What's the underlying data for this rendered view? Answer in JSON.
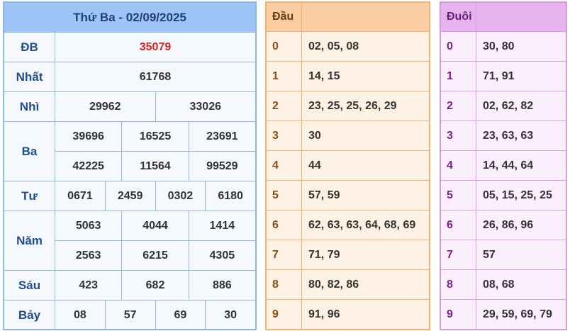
{
  "results": {
    "title": "Thứ Ba - 02/09/2025",
    "rows": [
      {
        "label": "ĐB",
        "lines": [
          [
            "35079"
          ]
        ]
      },
      {
        "label": "Nhất",
        "lines": [
          [
            "61768"
          ]
        ]
      },
      {
        "label": "Nhì",
        "lines": [
          [
            "29962",
            "33026"
          ]
        ]
      },
      {
        "label": "Ba",
        "lines": [
          [
            "39696",
            "16525",
            "23691"
          ],
          [
            "42225",
            "11564",
            "99529"
          ]
        ]
      },
      {
        "label": "Tư",
        "lines": [
          [
            "0671",
            "2459",
            "0302",
            "6180"
          ]
        ]
      },
      {
        "label": "Năm",
        "lines": [
          [
            "5063",
            "4044",
            "1414"
          ],
          [
            "2563",
            "6215",
            "4305"
          ]
        ]
      },
      {
        "label": "Sáu",
        "lines": [
          [
            "423",
            "682",
            "886"
          ]
        ]
      },
      {
        "label": "Bảy",
        "lines": [
          [
            "08",
            "57",
            "69",
            "30"
          ]
        ]
      }
    ],
    "special_color": "#e02020"
  },
  "dau": {
    "header": "Đầu",
    "rows": [
      {
        "k": "0",
        "v": "02, 05, 08"
      },
      {
        "k": "1",
        "v": "14, 15"
      },
      {
        "k": "2",
        "v": "23, 25, 25, 26, 29"
      },
      {
        "k": "3",
        "v": "30"
      },
      {
        "k": "4",
        "v": "44"
      },
      {
        "k": "5",
        "v": "57, 59"
      },
      {
        "k": "6",
        "v": "62, 63, 63, 64, 68, 69"
      },
      {
        "k": "7",
        "v": "71, 79"
      },
      {
        "k": "8",
        "v": "80, 82, 86"
      },
      {
        "k": "9",
        "v": "91, 96"
      }
    ]
  },
  "duoi": {
    "header": "Đuôi",
    "rows": [
      {
        "k": "0",
        "v": "30, 80"
      },
      {
        "k": "1",
        "v": "71, 91"
      },
      {
        "k": "2",
        "v": "02, 62, 82"
      },
      {
        "k": "3",
        "v": "23, 63, 63"
      },
      {
        "k": "4",
        "v": "14, 44, 64"
      },
      {
        "k": "5",
        "v": "05, 15, 25, 25"
      },
      {
        "k": "6",
        "v": "26, 86, 96"
      },
      {
        "k": "7",
        "v": "57"
      },
      {
        "k": "8",
        "v": "08, 68"
      },
      {
        "k": "9",
        "v": "29, 59, 69, 79"
      }
    ]
  }
}
